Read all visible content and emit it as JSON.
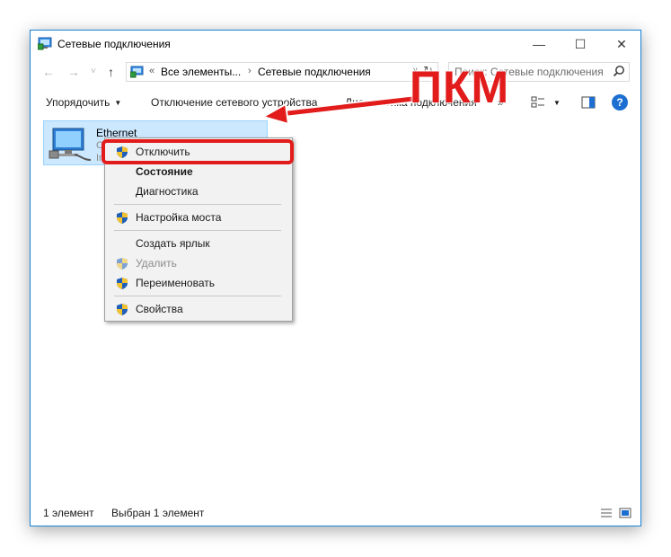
{
  "window": {
    "title": "Сетевые подключения",
    "controls": {
      "minimize": "—",
      "maximize": "☐",
      "close": "✕"
    }
  },
  "navigation": {
    "back": "←",
    "forward": "→",
    "recent": "˅",
    "up": "↑"
  },
  "address": {
    "overflow": "«",
    "crumbs": [
      "Все элементы...",
      "Сетевые подключения"
    ],
    "separator": "›",
    "dropdown": "˅",
    "refresh": "↻"
  },
  "search": {
    "placeholder": "Поиск: Сетевые подключения"
  },
  "commands": {
    "organize": "Упорядочить",
    "disable_device": "Отключение сетевого устройства",
    "diagnose": "Диагностика подключения",
    "more": "»"
  },
  "item": {
    "name": "Ethernet",
    "status_initial": "С",
    "device_initial": "In"
  },
  "context_menu": {
    "items": [
      {
        "label": "Отключить",
        "shield": true,
        "state": "highlighted"
      },
      {
        "label": "Состояние",
        "shield": false,
        "state": "default-bold"
      },
      {
        "label": "Диагностика",
        "shield": false,
        "state": "normal"
      },
      {
        "label": "Настройка моста",
        "shield": true,
        "state": "normal"
      },
      {
        "label": "Создать ярлык",
        "shield": false,
        "state": "normal"
      },
      {
        "label": "Удалить",
        "shield": true,
        "state": "disabled"
      },
      {
        "label": "Переименовать",
        "shield": true,
        "state": "normal"
      },
      {
        "label": "Свойства",
        "shield": true,
        "state": "normal"
      }
    ]
  },
  "status_bar": {
    "count": "1 элемент",
    "selected": "Выбран 1 элемент"
  },
  "annotation": {
    "label": "ПКМ",
    "color": "#e21b1b"
  },
  "colors": {
    "accent": "#1883d7",
    "selection": "#cce8ff",
    "help": "#1c6fd1"
  },
  "icons": [
    "network-connections-icon",
    "search-icon",
    "view-options-icon",
    "preview-pane-icon",
    "help-icon",
    "ethernet-adapter-icon",
    "uac-shield-icon",
    "details-view-icon",
    "large-icons-view-icon"
  ]
}
